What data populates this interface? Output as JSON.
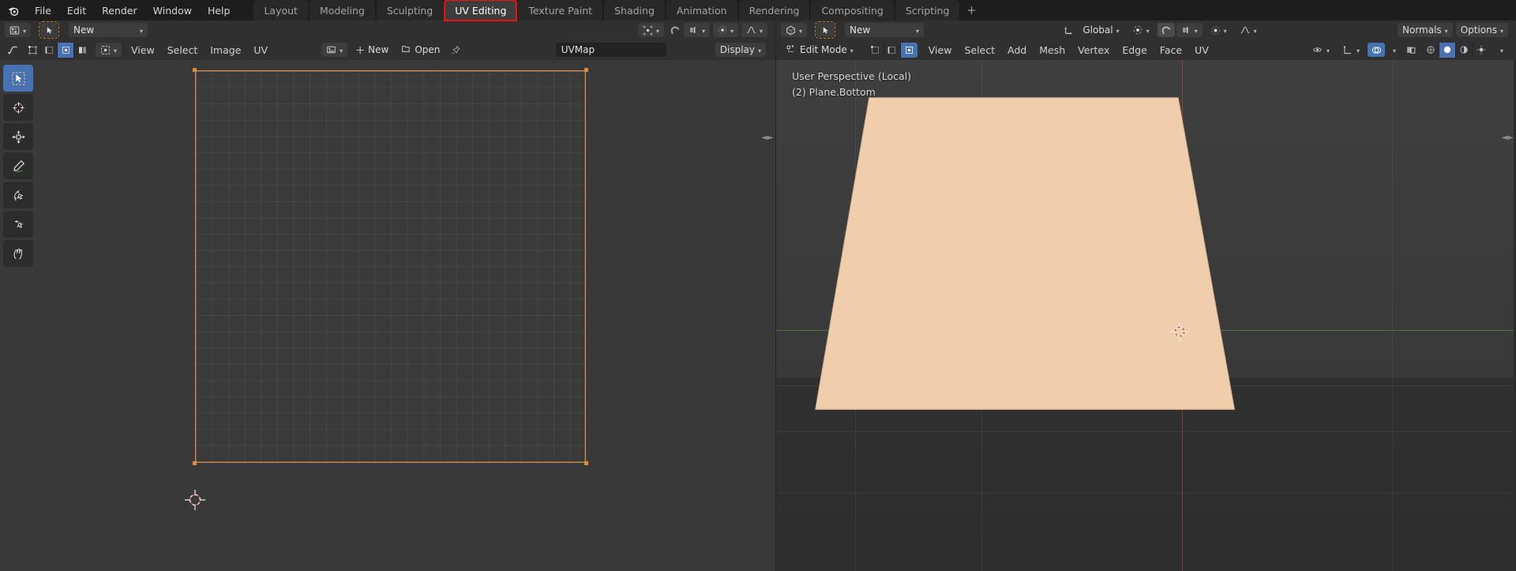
{
  "app": {
    "logo_icon": "blender-logo-icon"
  },
  "topbar": {
    "menus": [
      "File",
      "Edit",
      "Render",
      "Window",
      "Help"
    ],
    "workspace_tabs": [
      {
        "label": "Layout",
        "active": false,
        "highlighted": false
      },
      {
        "label": "Modeling",
        "active": false,
        "highlighted": false
      },
      {
        "label": "Sculpting",
        "active": false,
        "highlighted": false
      },
      {
        "label": "UV Editing",
        "active": true,
        "highlighted": true
      },
      {
        "label": "Texture Paint",
        "active": false,
        "highlighted": false
      },
      {
        "label": "Shading",
        "active": false,
        "highlighted": false
      },
      {
        "label": "Animation",
        "active": false,
        "highlighted": false
      },
      {
        "label": "Rendering",
        "active": false,
        "highlighted": false
      },
      {
        "label": "Compositing",
        "active": false,
        "highlighted": false
      },
      {
        "label": "Scripting",
        "active": false,
        "highlighted": false
      }
    ],
    "add_workspace_label": "+",
    "highlight_color": "#f11010"
  },
  "uv_editor": {
    "header_row1": {
      "editor_type_icon": "uv-editor-type-icon",
      "mode_icon": "uv-select-mode-icon",
      "mode_value": "New",
      "pivot_icon": "pivot-point-icon",
      "snap_icon": "snap-magnet-icon",
      "proportional_icon": "proportional-edit-icon",
      "proportional_falloff_icon": "falloff-curve-icon"
    },
    "header_row2": {
      "editor_type_icon": "uv-editor-type-icon",
      "select_modes": [
        "vertex-select-icon",
        "edge-select-icon",
        "face-select-icon",
        "island-select-icon"
      ],
      "active_select_mode_index": 2,
      "sync_icon": "uv-sync-selection-icon",
      "menus": [
        "View",
        "Select",
        "Image",
        "UV"
      ],
      "image_browse_icon": "image-browse-icon",
      "new_label": "New",
      "new_icon": "plus-icon",
      "open_label": "Open",
      "open_icon": "folder-open-icon",
      "pin_icon": "pin-icon",
      "uvmap_field_value": "UVMap",
      "display_label": "Display"
    },
    "tools": [
      {
        "name": "tweak-select-box-tool",
        "active": true
      },
      {
        "name": "cursor-tool",
        "active": false
      },
      {
        "name": "move-tool",
        "active": false
      },
      {
        "name": "annotate-tool",
        "active": false
      },
      {
        "name": "rotate-tool",
        "active": false
      },
      {
        "name": "scale-tool",
        "active": false
      },
      {
        "name": "transform-tool",
        "active": false
      }
    ],
    "canvas": {
      "grid_color": "#3a3a3a",
      "outline_color": "#d98b4a",
      "cursor_icon": "2d-cursor-icon"
    }
  },
  "viewport": {
    "header_row1": {
      "editor_type_icon": "3d-viewport-type-icon",
      "mode_icon": "object-mode-icon",
      "mode_value": "New",
      "transform_orientation_icon": "orientation-icon",
      "transform_orientation_value": "Global",
      "pivot_icon": "pivot-point-icon",
      "snap_icon": "snap-magnet-icon",
      "snap_target_icon": "snap-target-icon",
      "proportional_icon": "proportional-edit-icon",
      "falloff_icon": "falloff-curve-icon",
      "normals_label": "Normals",
      "options_label": "Options"
    },
    "header_row2": {
      "editor_type_icon": "3d-viewport-type-icon",
      "mode_value": "Edit Mode",
      "select_modes": [
        "vertex-select-icon",
        "edge-select-icon",
        "face-select-icon"
      ],
      "active_select_mode_index": 2,
      "menus": [
        "View",
        "Select",
        "Add",
        "Mesh",
        "Vertex",
        "Edge",
        "Face",
        "UV"
      ],
      "visibility_icon": "object-visibility-icon",
      "gizmo_icon": "gizmo-icon",
      "overlays_icon": "overlays-icon",
      "xray_icon": "xray-toggle-icon",
      "shading_modes": [
        "wireframe-shading-icon",
        "solid-shading-icon",
        "material-shading-icon",
        "rendered-shading-icon"
      ],
      "active_shading_index": 1
    },
    "overlay_text": {
      "line1": "User Perspective (Local)",
      "line2": "(2) Plane.Bottom"
    },
    "object": {
      "name": "Plane.Bottom",
      "fill_color": "#f0cdab",
      "edge_color": "#d7b48f"
    },
    "axes": {
      "x_axis_color": "#6ea046",
      "y_axis_color": "#b44646"
    },
    "cursor_icon": "3d-cursor-icon"
  }
}
